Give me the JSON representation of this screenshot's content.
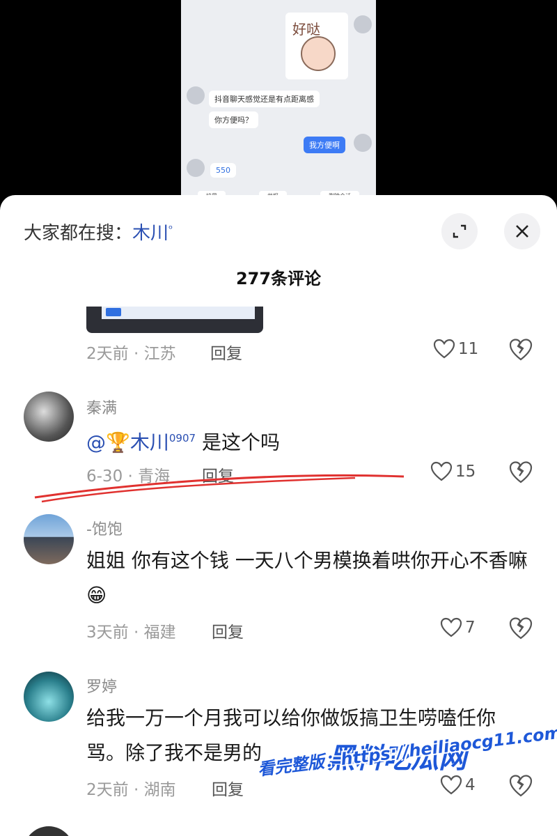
{
  "video": {
    "chat": [
      {
        "text": "抖音聊天感觉还是有点距离感"
      },
      {
        "text": "你方便吗？"
      },
      {
        "text": "我方便啊"
      },
      {
        "text": "550"
      }
    ],
    "sticker_text": "好哒",
    "toolbar": [
      "拉黑",
      "举报",
      "删除会话"
    ]
  },
  "header": {
    "search_prefix": "大家都在搜：",
    "search_keyword": "木川",
    "title": "277条评论"
  },
  "comments": [
    {
      "meta": "2天前 · 江苏",
      "reply": "回复",
      "likes": "11"
    },
    {
      "user": "秦满",
      "mention": "@🏆木川",
      "mention_sup": "0907",
      "text": " 是这个吗",
      "meta": "6-30 · 青海",
      "reply": "回复",
      "likes": "15"
    },
    {
      "user": "-饱饱",
      "text": "姐姐 你有这个钱 一天八个男模换着哄你开心不香嘛😁",
      "meta": "3天前 · 福建",
      "reply": "回复",
      "likes": "7"
    },
    {
      "user": "罗婷",
      "text": "给我一万一个月我可以给你做饭搞卫生唠嗑任你骂。除了我不是男的",
      "meta": "2天前 · 湖南",
      "reply": "回复",
      "likes": "4"
    }
  ],
  "watermark": {
    "brand": "黑料吃瓜网",
    "url_line": "看完整版：https://heiliaocg11.com"
  },
  "colors": {
    "accent": "#2a4fb2",
    "underline": "#e0312f",
    "watermark": "#1e58d8"
  }
}
